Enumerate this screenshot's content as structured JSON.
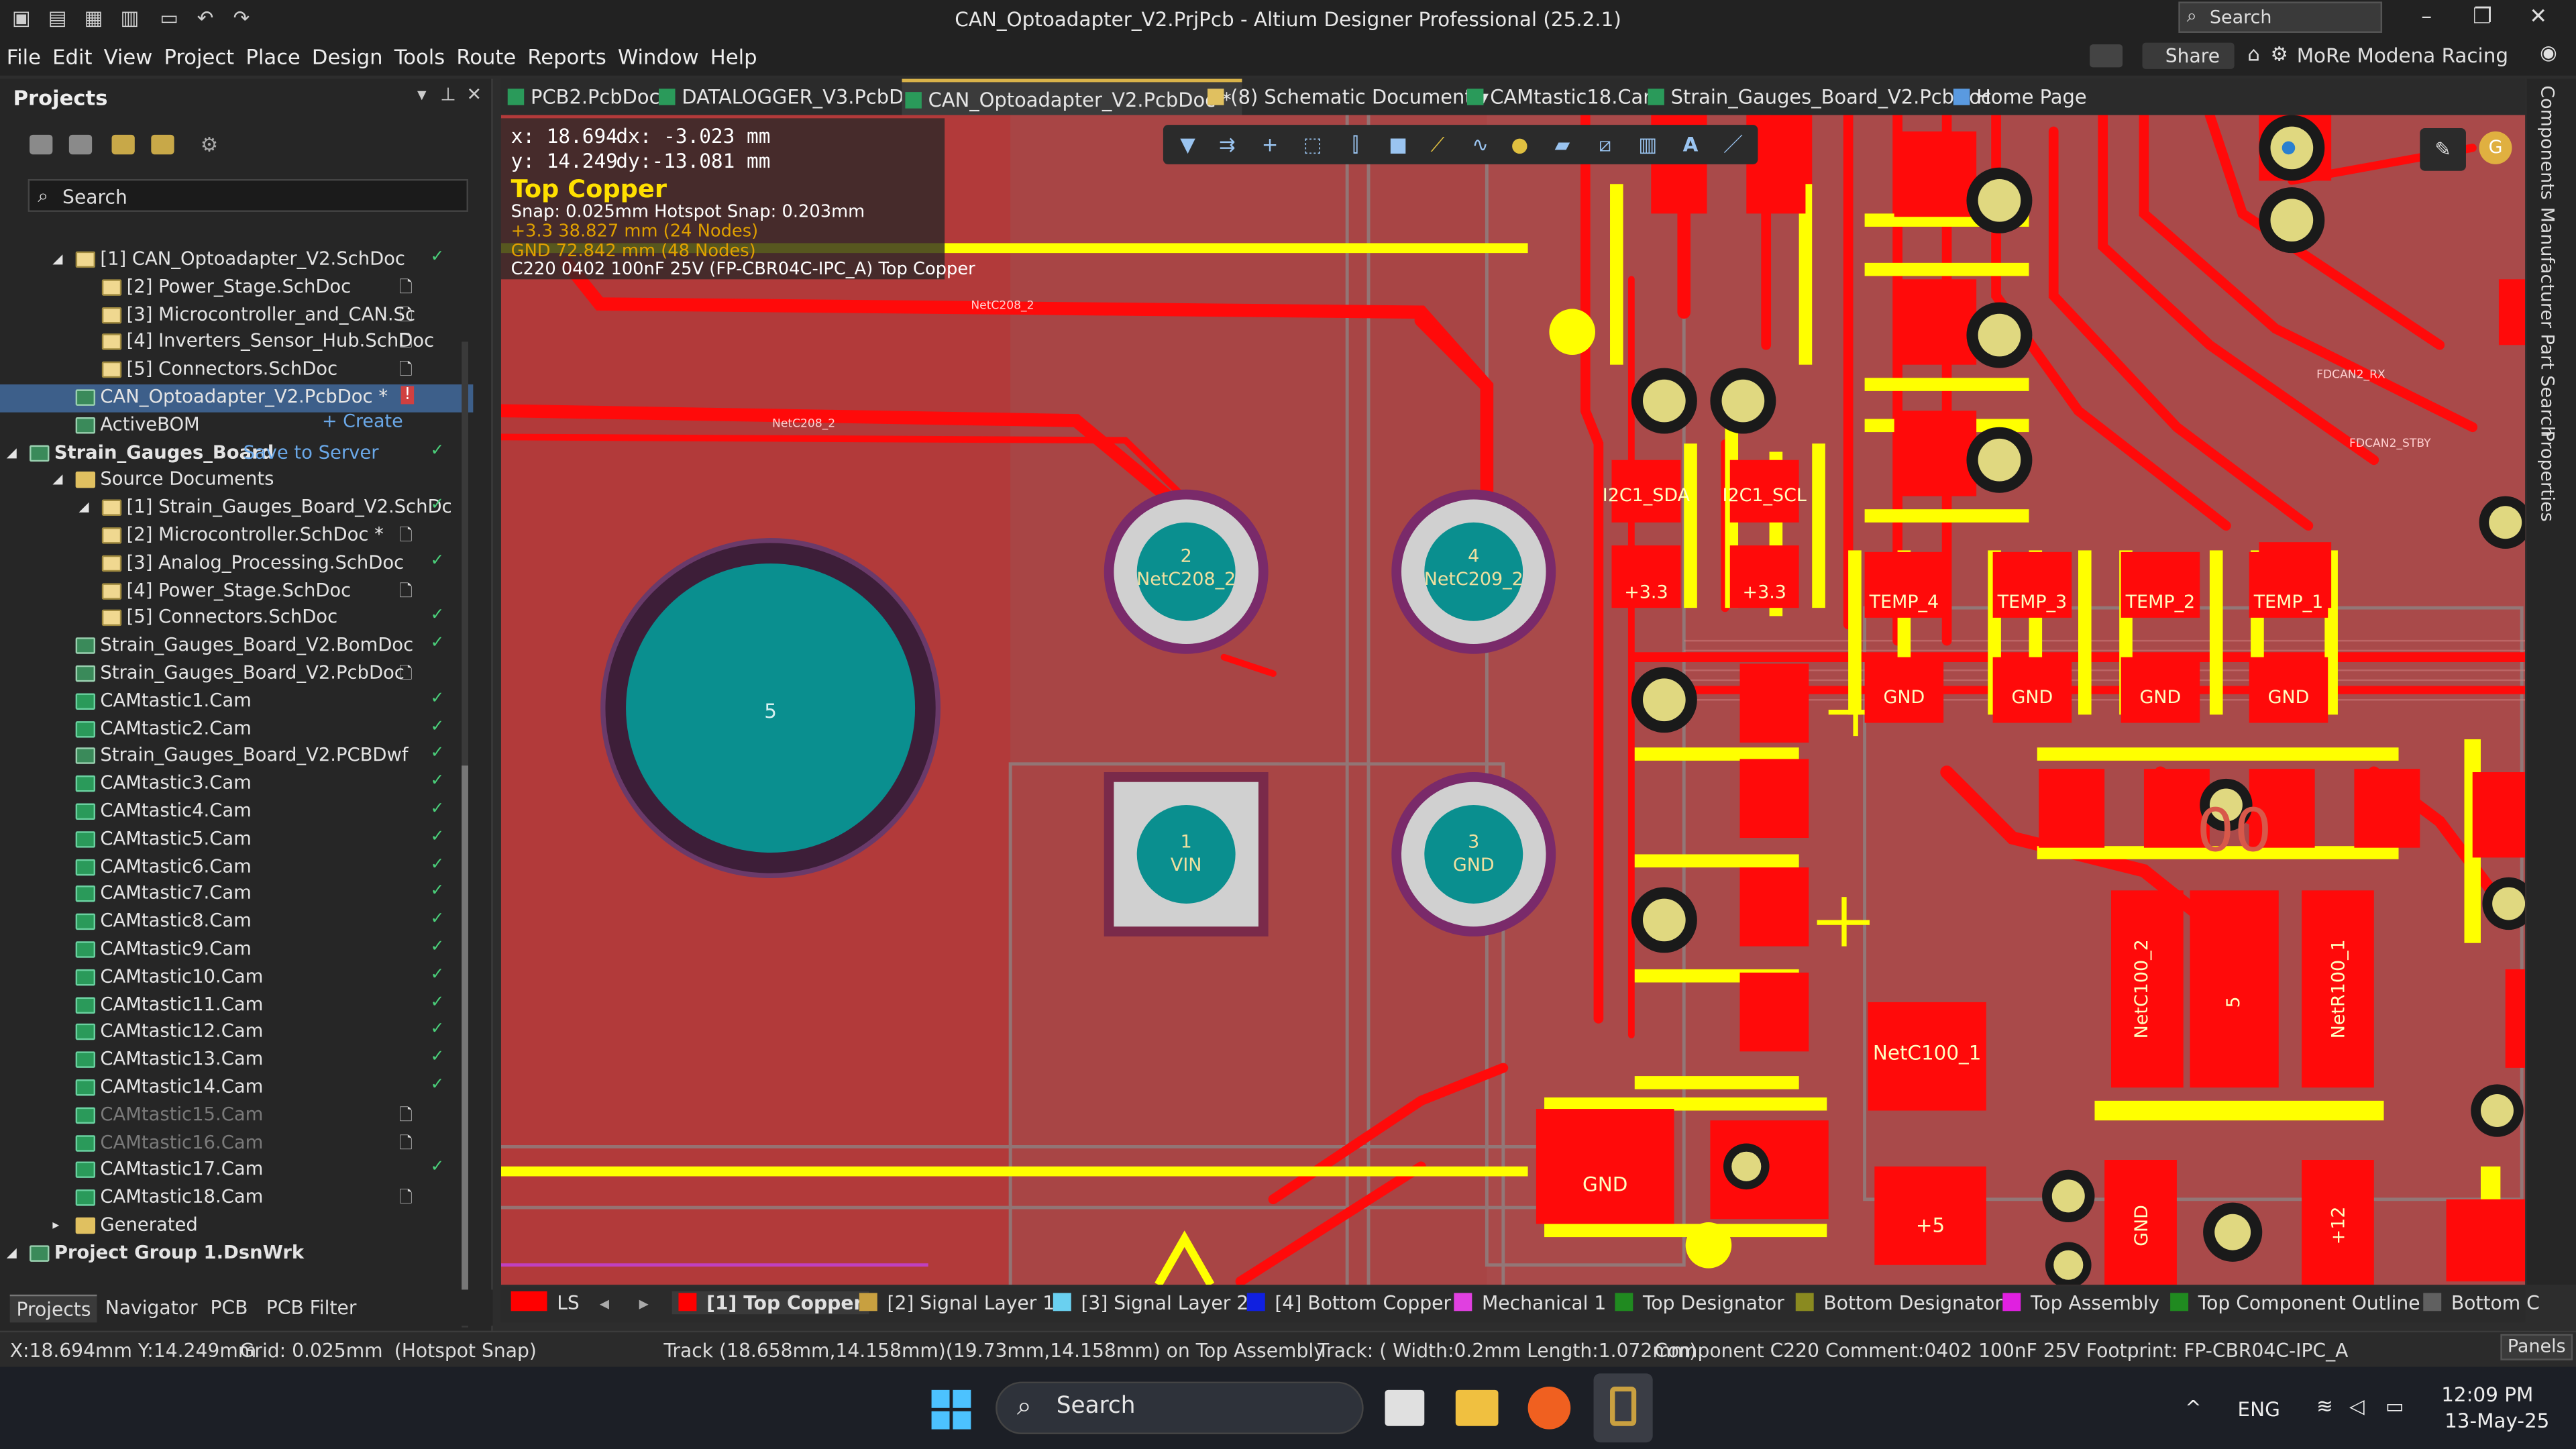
{
  "window": {
    "title": "CAN_Optoadapter_V2.PrjPcb - Altium Designer Professional (25.2.1)",
    "search_label": "Search",
    "controls": [
      "–",
      "❐",
      "✕"
    ]
  },
  "menu": {
    "items": [
      "File",
      "Edit",
      "View",
      "Project",
      "Place",
      "Design",
      "Tools",
      "Route",
      "Reports",
      "Window",
      "Help"
    ],
    "share": "Share",
    "account": "MoRe Modena Racing"
  },
  "projects_panel": {
    "title": "Projects",
    "search_placeholder": "Search",
    "create_label": "+ Create",
    "rows": [
      {
        "label": "[1] CAN_Optoadapter_V2.SchDoc",
        "indent": 1,
        "icon": "sch",
        "status": "check"
      },
      {
        "label": "[2] Power_Stage.SchDoc",
        "indent": 2,
        "icon": "sch",
        "status": "doc"
      },
      {
        "label": "[3] Microcontroller_and_CAN.Sc",
        "indent": 2,
        "icon": "sch",
        "status": "doc"
      },
      {
        "label": "[4] Inverters_Sensor_Hub.SchDoc",
        "indent": 2,
        "icon": "sch",
        "status": "doc"
      },
      {
        "label": "[5] Connectors.SchDoc",
        "indent": 2,
        "icon": "sch",
        "status": "doc"
      },
      {
        "label": "CAN_Optoadapter_V2.PcbDoc *",
        "indent": 1,
        "icon": "pcb",
        "status": "error",
        "selected": true
      },
      {
        "label": "ActiveBOM",
        "indent": 1,
        "icon": "bom",
        "status": "none"
      },
      {
        "label": "Strain_Gauges_Board",
        "indent": 0,
        "icon": "proj",
        "status": "check",
        "extra": "Save to Server"
      },
      {
        "label": "Source Documents",
        "indent": 1,
        "icon": "fold",
        "status": "none"
      },
      {
        "label": "[1] Strain_Gauges_Board_V2.SchDc",
        "indent": 2,
        "icon": "sch",
        "status": "check"
      },
      {
        "label": "[2] Microcontroller.SchDoc *",
        "indent": 3,
        "icon": "sch",
        "status": "doc"
      },
      {
        "label": "[3] Analog_Processing.SchDoc",
        "indent": 3,
        "icon": "sch",
        "status": "check"
      },
      {
        "label": "[4] Power_Stage.SchDoc",
        "indent": 3,
        "icon": "sch",
        "status": "doc"
      },
      {
        "label": "[5] Connectors.SchDoc",
        "indent": 3,
        "icon": "sch",
        "status": "check"
      },
      {
        "label": "Strain_Gauges_Board_V2.BomDoc",
        "indent": 1,
        "icon": "pcb",
        "status": "check"
      },
      {
        "label": "Strain_Gauges_Board_V2.PcbDoc",
        "indent": 1,
        "icon": "pcb",
        "status": "doc"
      },
      {
        "label": "CAMtastic1.Cam",
        "indent": 1,
        "icon": "cam",
        "status": "check"
      },
      {
        "label": "CAMtastic2.Cam",
        "indent": 1,
        "icon": "cam",
        "status": "check"
      },
      {
        "label": "Strain_Gauges_Board_V2.PCBDwf",
        "indent": 1,
        "icon": "pcb",
        "status": "check"
      },
      {
        "label": "CAMtastic3.Cam",
        "indent": 1,
        "icon": "cam",
        "status": "check"
      },
      {
        "label": "CAMtastic4.Cam",
        "indent": 1,
        "icon": "cam",
        "status": "check"
      },
      {
        "label": "CAMtastic5.Cam",
        "indent": 1,
        "icon": "cam",
        "status": "check"
      },
      {
        "label": "CAMtastic6.Cam",
        "indent": 1,
        "icon": "cam",
        "status": "check"
      },
      {
        "label": "CAMtastic7.Cam",
        "indent": 1,
        "icon": "cam",
        "status": "check"
      },
      {
        "label": "CAMtastic8.Cam",
        "indent": 1,
        "icon": "cam",
        "status": "check"
      },
      {
        "label": "CAMtastic9.Cam",
        "indent": 1,
        "icon": "cam",
        "status": "check"
      },
      {
        "label": "CAMtastic10.Cam",
        "indent": 1,
        "icon": "cam",
        "status": "check"
      },
      {
        "label": "CAMtastic11.Cam",
        "indent": 1,
        "icon": "cam",
        "status": "check"
      },
      {
        "label": "CAMtastic12.Cam",
        "indent": 1,
        "icon": "cam",
        "status": "check"
      },
      {
        "label": "CAMtastic13.Cam",
        "indent": 1,
        "icon": "cam",
        "status": "check"
      },
      {
        "label": "CAMtastic14.Cam",
        "indent": 1,
        "icon": "cam",
        "status": "check"
      },
      {
        "label": "CAMtastic15.Cam",
        "indent": 1,
        "icon": "cam",
        "status": "doc",
        "dim": true
      },
      {
        "label": "CAMtastic16.Cam",
        "indent": 1,
        "icon": "cam",
        "status": "doc",
        "dim": true
      },
      {
        "label": "CAMtastic17.Cam",
        "indent": 1,
        "icon": "cam",
        "status": "check"
      },
      {
        "label": "CAMtastic18.Cam",
        "indent": 1,
        "icon": "cam",
        "status": "doc"
      },
      {
        "label": "Generated",
        "indent": 1,
        "icon": "fold",
        "status": "none"
      },
      {
        "label": "Project Group 1.DsnWrk",
        "indent": 0,
        "icon": "proj",
        "status": "none",
        "bold": true
      }
    ],
    "bottom_tabs": [
      "Projects",
      "Navigator",
      "PCB",
      "PCB Filter"
    ]
  },
  "doc_tabs": [
    {
      "label": "PCB2.PcbDoc"
    },
    {
      "label": "DATALOGGER_V3.PcbDoc"
    },
    {
      "label": "CAN_Optoadapter_V2.PcbDoc *",
      "active": true
    },
    {
      "label": "(8) Schematic Document"
    },
    {
      "label": "CAMtastic18.Cam"
    },
    {
      "label": "Strain_Gauges_Board_V2.PcbDoc"
    },
    {
      "label": "Home Page"
    }
  ],
  "hud": {
    "x": "x: 18.694",
    "dx": "dx: -3.023  mm",
    "y": "y: 14.249",
    "dy": "dy:-13.081 mm",
    "layer": "Top Copper",
    "snap": "Snap: 0.025mm Hotspot Snap: 0.203mm",
    "net1": "+3.3  38.827 mm (24 Nodes)",
    "net2": "GND  72.842 mm (48 Nodes)",
    "component": "C220 0402 100nF 25V (FP-CBR04C-IPC_A) Top Copper"
  },
  "pcb_labels": {
    "pad5": "5",
    "pad_vin_num": "1",
    "pad_vin": "VIN",
    "pad_gnd_num": "3",
    "pad_gnd": "GND",
    "pad2_num": "2",
    "pad2": "NetC208_2",
    "pad4_num": "4",
    "pad4": "NetC209_2",
    "net_c208": "NetC208_2",
    "net_c209": "NetC209_2",
    "i2c_sda": "I2C1_SDA",
    "i2c_scl": "I2C1_SCL",
    "plus33": "+3.3",
    "temp4": "TEMP_4",
    "temp3": "TEMP_3",
    "temp2": "TEMP_2",
    "temp1": "TEMP_1",
    "gnd": "GND",
    "netc100_1": "NetC100_1",
    "netc100_2": "NetC100_2",
    "netr100_1": "NetR100_1",
    "plus5": "+5",
    "plus12": "+12",
    "pad_two": "2",
    "pad_one": "1",
    "pad_five": "5",
    "fdcan_rx": "FDCAN2_RX",
    "fdcan_stby": "FDCAN2_STBY"
  },
  "right_panels": [
    "Components",
    "Manufacturer Part Search",
    "Properties"
  ],
  "layer_tabs": [
    {
      "label": "LS",
      "color": "#ff0000"
    },
    {
      "label": "[1] Top Copper",
      "color": "#ff0000",
      "active": true
    },
    {
      "label": "[2] Signal Layer 1",
      "color": "#c8a040"
    },
    {
      "label": "[3] Signal Layer 2",
      "color": "#6ad0f0"
    },
    {
      "label": "[4] Bottom Copper",
      "color": "#1020e0"
    },
    {
      "label": "Mechanical 1",
      "color": "#e040e0"
    },
    {
      "label": "Top Designator",
      "color": "#208a20"
    },
    {
      "label": "Bottom Designator",
      "color": "#8a8a20"
    },
    {
      "label": "Top Assembly",
      "color": "#e020e0"
    },
    {
      "label": "Top Component Outline",
      "color": "#208a20"
    },
    {
      "label": "Bottom C",
      "color": "#606060"
    }
  ],
  "status": {
    "coords": "X:18.694mm Y:14.249mm",
    "grid": "Grid: 0.025mm",
    "hotspot": "(Hotspot Snap)",
    "track": "Track (18.658mm,14.158mm)(19.73mm,14.158mm) on Top Assembly",
    "track_info": "Track: ( Width:0.2mm Length:1.072mm)",
    "component": "Component C220 Comment:0402 100nF 25V Footprint: FP-CBR04C-IPC_A",
    "panels": "Panels"
  },
  "taskbar": {
    "search": "Search",
    "lang": "ENG",
    "time": "12:09 PM",
    "date": "13-May-25"
  },
  "colors": {
    "board": "#b5413f",
    "track": "#ff0a0a",
    "pad_teal": "#0a8f8f",
    "silk": "#ffff00",
    "accent": "#d9b34a"
  }
}
